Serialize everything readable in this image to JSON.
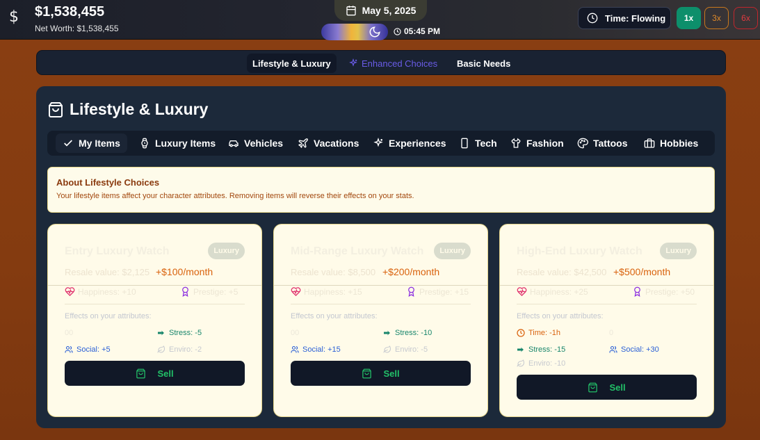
{
  "header": {
    "money": "$1,538,455",
    "net_worth": "Net Worth: $1,538,455",
    "date": "May 5, 2025",
    "time": "05:45 PM",
    "time_mode": "Time: Flowing",
    "speeds": [
      "1x",
      "3x",
      "6x"
    ],
    "active_speed": "1x"
  },
  "nav": {
    "items": [
      "Lifestyle & Luxury",
      "Enhanced Choices",
      "Basic Needs"
    ],
    "active": "Lifestyle & Luxury"
  },
  "panel": {
    "title": "Lifestyle & Luxury",
    "tabs": [
      "My Items",
      "Luxury Items",
      "Vehicles",
      "Vacations",
      "Experiences",
      "Tech",
      "Fashion",
      "Tattoos",
      "Hobbies"
    ],
    "active_tab": "My Items",
    "about": {
      "title": "About Lifestyle Choices",
      "text": "Your lifestyle items affect your character attributes. Removing items will reverse their effects on your stats."
    },
    "effects_heading": "Effects on your attributes:",
    "sell_label": "Sell"
  },
  "cards": [
    {
      "title": "Entry Luxury Watch",
      "badge": "Luxury",
      "resale": "Resale value: $2,125",
      "monthly": "+$100/month",
      "stat_a": "Happiness: +10",
      "stat_b": "Prestige: +5",
      "effects": [
        "00",
        "Stress: -5",
        "Social: +5",
        "Enviro: -2"
      ]
    },
    {
      "title": "Mid-Range Luxury Watch",
      "badge": "Luxury",
      "resale": "Resale value: $8,500",
      "monthly": "+$200/month",
      "stat_a": "Happiness: +15",
      "stat_b": "Prestige: +15",
      "effects": [
        "00",
        "Stress: -10",
        "Social: +15",
        "Enviro: -5"
      ]
    },
    {
      "title": "High-End Luxury Watch",
      "badge": "Luxury",
      "resale": "Resale value: $42,500",
      "monthly": "+$500/month",
      "stat_a": "Happiness: +25",
      "stat_b": "Prestige: +50",
      "effects": [
        "Time: -1h",
        "0",
        "Stress: -15",
        "Social: +30",
        "Enviro: -10"
      ]
    }
  ],
  "colors": {
    "accent_green": "#0d8f6b",
    "sell_text": "#22c068",
    "monthly": "#d9620d",
    "enhanced": "#6a5ce8"
  }
}
